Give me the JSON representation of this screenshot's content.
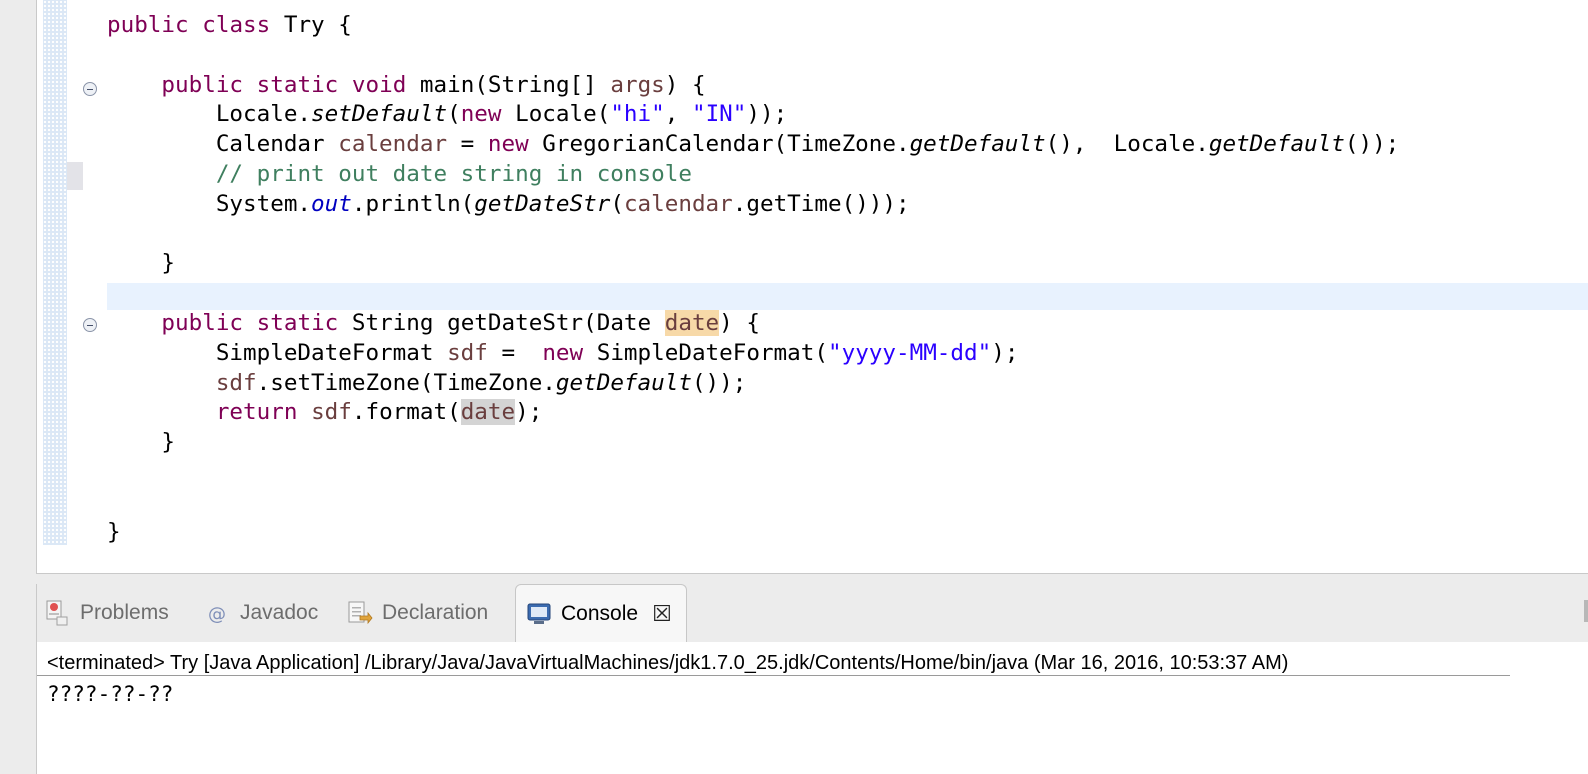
{
  "editor": {
    "lines": [
      [
        {
          "t": "public",
          "c": "kw"
        },
        {
          "t": " "
        },
        {
          "t": "class",
          "c": "kw"
        },
        {
          "t": " Try {"
        }
      ],
      [],
      [
        {
          "t": "    "
        },
        {
          "t": "public",
          "c": "kw"
        },
        {
          "t": " "
        },
        {
          "t": "static",
          "c": "kw"
        },
        {
          "t": " "
        },
        {
          "t": "void",
          "c": "kw"
        },
        {
          "t": " main(String[] "
        },
        {
          "t": "args",
          "c": "var"
        },
        {
          "t": ") {"
        }
      ],
      [
        {
          "t": "        Locale."
        },
        {
          "t": "setDefault",
          "c": "ital"
        },
        {
          "t": "("
        },
        {
          "t": "new",
          "c": "kw"
        },
        {
          "t": " Locale("
        },
        {
          "t": "\"hi\"",
          "c": "str"
        },
        {
          "t": ", "
        },
        {
          "t": "\"IN\"",
          "c": "str"
        },
        {
          "t": "));"
        }
      ],
      [
        {
          "t": "        Calendar "
        },
        {
          "t": "calendar",
          "c": "var"
        },
        {
          "t": " = "
        },
        {
          "t": "new",
          "c": "kw"
        },
        {
          "t": " GregorianCalendar(TimeZone."
        },
        {
          "t": "getDefault",
          "c": "ital"
        },
        {
          "t": "(),  Locale."
        },
        {
          "t": "getDefault",
          "c": "ital"
        },
        {
          "t": "());"
        }
      ],
      [
        {
          "t": "        "
        },
        {
          "t": "// print out date string in console",
          "c": "cmt"
        }
      ],
      [
        {
          "t": "        System."
        },
        {
          "t": "out",
          "c": "stat"
        },
        {
          "t": ".println("
        },
        {
          "t": "getDateStr",
          "c": "ital"
        },
        {
          "t": "("
        },
        {
          "t": "calendar",
          "c": "var"
        },
        {
          "t": ".getTime()));"
        }
      ],
      [],
      [
        {
          "t": "    }"
        }
      ],
      [],
      [
        {
          "t": "    "
        },
        {
          "t": "public",
          "c": "kw"
        },
        {
          "t": " "
        },
        {
          "t": "static",
          "c": "kw"
        },
        {
          "t": " String getDateStr(Date "
        },
        {
          "t": "date",
          "c": "var occ-w"
        },
        {
          "t": ") {"
        }
      ],
      [
        {
          "t": "        SimpleDateFormat "
        },
        {
          "t": "sdf",
          "c": "var"
        },
        {
          "t": " =  "
        },
        {
          "t": "new",
          "c": "kw"
        },
        {
          "t": " SimpleDateFormat("
        },
        {
          "t": "\"yyyy-MM-dd\"",
          "c": "str"
        },
        {
          "t": ");"
        }
      ],
      [
        {
          "t": "        "
        },
        {
          "t": "sdf",
          "c": "var"
        },
        {
          "t": ".setTimeZone(TimeZone."
        },
        {
          "t": "getDefault",
          "c": "ital"
        },
        {
          "t": "());"
        }
      ],
      [
        {
          "t": "        "
        },
        {
          "t": "return",
          "c": "kw"
        },
        {
          "t": " "
        },
        {
          "t": "sdf",
          "c": "var"
        },
        {
          "t": ".format("
        },
        {
          "t": "date",
          "c": "var occ-r"
        },
        {
          "t": ");"
        }
      ],
      [
        {
          "t": "    }"
        }
      ],
      [],
      [],
      [
        {
          "t": "}"
        }
      ]
    ]
  },
  "tabs": [
    {
      "label": "Problems",
      "icon": "problems-icon"
    },
    {
      "label": "Javadoc",
      "icon": "javadoc-icon"
    },
    {
      "label": "Declaration",
      "icon": "declaration-icon"
    },
    {
      "label": "Console",
      "icon": "console-icon",
      "active": true
    }
  ],
  "console": {
    "status": "<terminated> Try [Java Application] /Library/Java/JavaVirtualMachines/jdk1.7.0_25.jdk/Contents/Home/bin/java (Mar 16, 2016, 10:53:37 AM)",
    "output": "????-??-??",
    "close_glyph": "☒"
  },
  "colors": {
    "keyword": "#7f0055",
    "string": "#2a00ff",
    "local_var": "#6a3e3e",
    "static_field": "#0000c0",
    "comment": "#3f7f5f",
    "current_line": "#e8f2fe"
  }
}
